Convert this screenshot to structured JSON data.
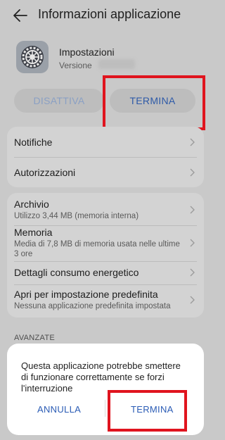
{
  "header": {
    "title": "Informazioni applicazione",
    "back_icon": "arrow-left-icon"
  },
  "app": {
    "name": "Impostazioni",
    "version_label": "Versione",
    "icon": "settings-gear-icon"
  },
  "actions": {
    "disable_label": "DISATTIVA",
    "stop_label": "TERMINA"
  },
  "card1": {
    "items": [
      {
        "label": "Notifiche"
      },
      {
        "label": "Autorizzazioni"
      }
    ]
  },
  "card2": {
    "items": [
      {
        "label": "Archivio",
        "sub": "Utilizzo 3,44 MB (memoria interna)"
      },
      {
        "label": "Memoria",
        "sub": "Media di 7,8 MB di memoria usata nelle ultime 3 ore"
      },
      {
        "label": "Dettagli consumo energetico"
      },
      {
        "label": "Apri per impostazione predefinita",
        "sub": "Nessuna applicazione predefinita impostata"
      }
    ]
  },
  "advanced_label": "AVANZATE",
  "dialog": {
    "message": "Questa applicazione potrebbe smettere di funzionare correttamente se forzi l'interruzione",
    "cancel_label": "ANNULLA",
    "confirm_label": "TERMINA"
  },
  "colors": {
    "accent": "#2b5cb5",
    "highlight": "#e0141e"
  }
}
